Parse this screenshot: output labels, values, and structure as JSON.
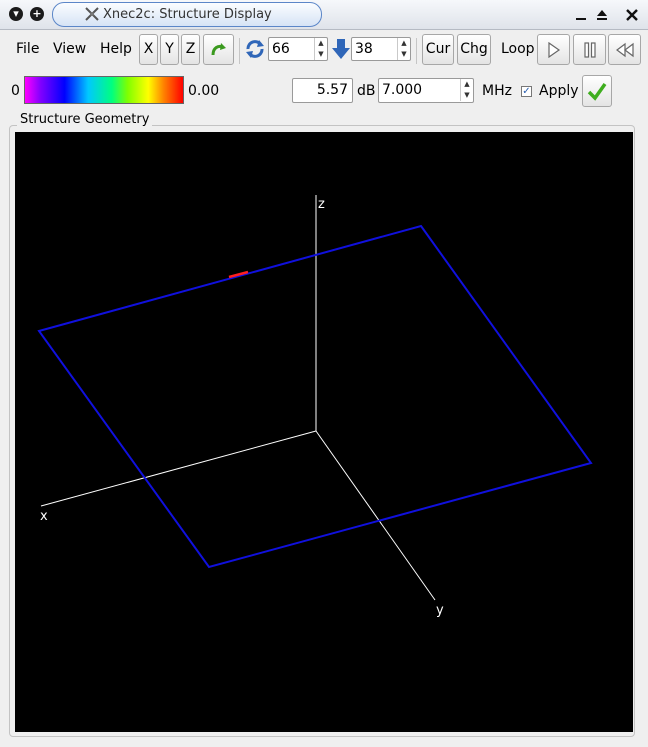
{
  "window": {
    "title": "Xnec2c: Structure Display",
    "menu_circle_glyph": "▾",
    "add_circle_glyph": "+"
  },
  "menu": {
    "file": "File",
    "view": "View",
    "help": "Help"
  },
  "toolbar": {
    "x_label": "X",
    "y_label": "Y",
    "z_label": "Z",
    "rotate_value": "66",
    "incline_value": "38",
    "cur_label": "Cur",
    "chg_label": "Chg",
    "loop_label": "Loop"
  },
  "scale": {
    "min_label": "0",
    "max_label": "0.00"
  },
  "frequency": {
    "gain_value": "5.57",
    "gain_unit": "dB",
    "freq_value": "7.000",
    "freq_unit": "MHz",
    "apply_label": "Apply",
    "apply_checked": true
  },
  "structure": {
    "frame_title": "Structure Geometry",
    "axis_x": "x",
    "axis_y": "y",
    "axis_z": "z"
  },
  "colors": {
    "wire": "#1010dd",
    "excitation": "#ff2020",
    "axes": "#ffffff",
    "background": "#000000"
  }
}
